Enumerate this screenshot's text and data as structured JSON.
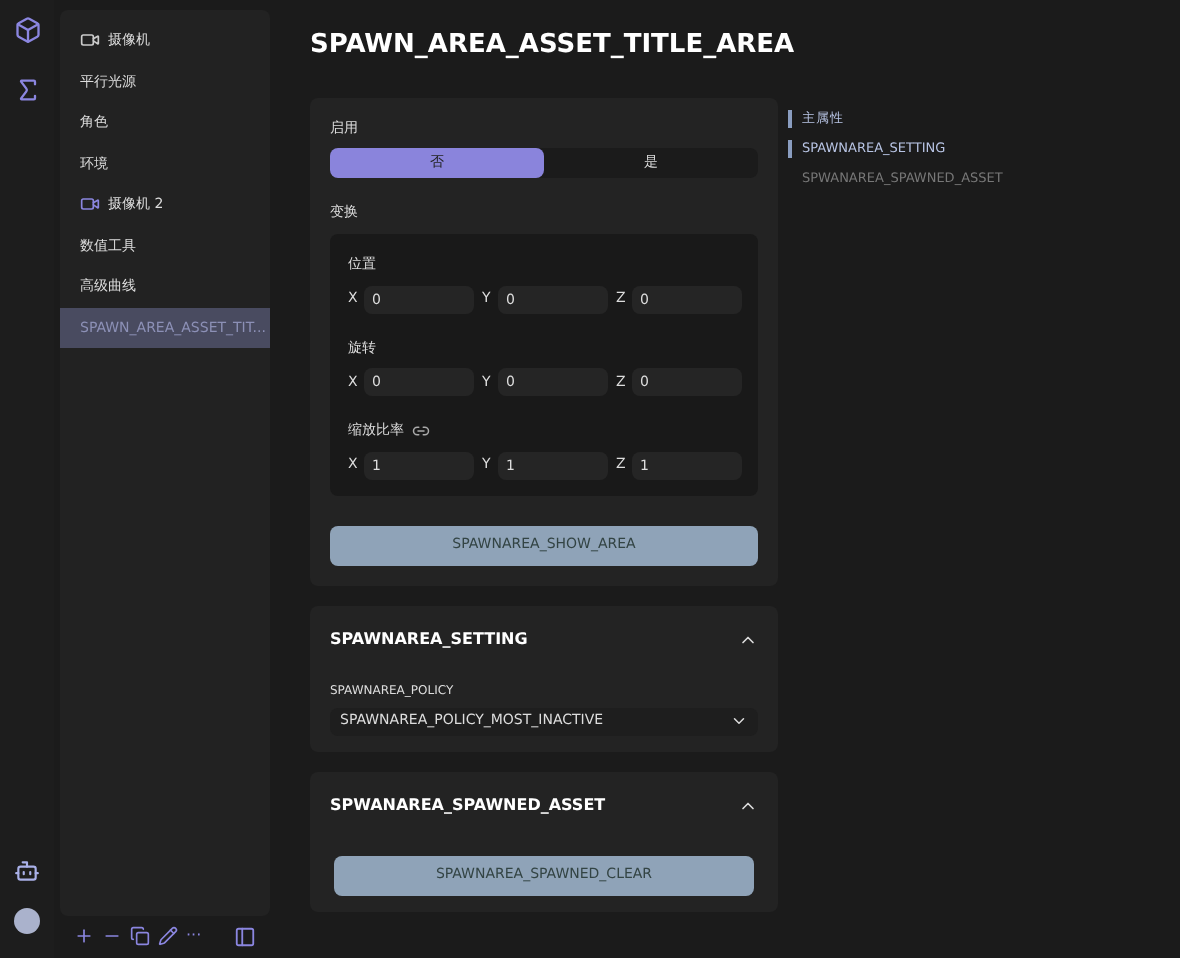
{
  "sidebar": {
    "items": [
      {
        "label": "摄像机",
        "kind": "camera",
        "selected": false
      },
      {
        "label": "平行光源",
        "kind": "plain",
        "selected": false
      },
      {
        "label": "角色",
        "kind": "plain",
        "selected": false
      },
      {
        "label": "环境",
        "kind": "plain",
        "selected": false
      },
      {
        "label": "摄像机 2",
        "kind": "camera",
        "selected": false
      },
      {
        "label": "数值工具",
        "kind": "plain",
        "selected": false
      },
      {
        "label": "高级曲线",
        "kind": "plain",
        "selected": false
      },
      {
        "label": "SPAWN_AREA_ASSET_TIT...",
        "kind": "plain",
        "selected": true
      }
    ]
  },
  "toolbar": {
    "more": "···"
  },
  "title": "SPAWN_AREA_ASSET_TITLE_AREA",
  "enable": {
    "label": "启用",
    "options": [
      {
        "label": "否",
        "selected": true
      },
      {
        "label": "是",
        "selected": false
      }
    ]
  },
  "transform": {
    "label": "变换",
    "groups": [
      {
        "label": "位置",
        "linked": false,
        "fields": [
          {
            "axis": "X",
            "value": "0"
          },
          {
            "axis": "Y",
            "value": "0"
          },
          {
            "axis": "Z",
            "value": "0"
          }
        ]
      },
      {
        "label": "旋转",
        "linked": false,
        "fields": [
          {
            "axis": "X",
            "value": "0"
          },
          {
            "axis": "Y",
            "value": "0"
          },
          {
            "axis": "Z",
            "value": "0"
          }
        ]
      },
      {
        "label": "缩放比率",
        "linked": true,
        "fields": [
          {
            "axis": "X",
            "value": "1"
          },
          {
            "axis": "Y",
            "value": "1"
          },
          {
            "axis": "Z",
            "value": "1"
          }
        ]
      }
    ]
  },
  "show_button": "SPAWNAREA_SHOW_AREA",
  "sections": [
    {
      "title": "SPAWNAREA_SETTING",
      "expanded": true,
      "kind": "select",
      "label": "SPAWNAREA_POLICY",
      "value": "SPAWNAREA_POLICY_MOST_INACTIVE"
    },
    {
      "title": "SPWANAREA_SPAWNED_ASSET",
      "expanded": true,
      "kind": "button",
      "value": "SPAWNAREA_SPAWNED_CLEAR"
    }
  ],
  "outline": [
    {
      "label": "主属性",
      "selected": true
    },
    {
      "label": "SPAWNAREA_SETTING",
      "selected": true
    },
    {
      "label": "SPWANAREA_SPAWNED_ASSET",
      "selected": false
    }
  ]
}
